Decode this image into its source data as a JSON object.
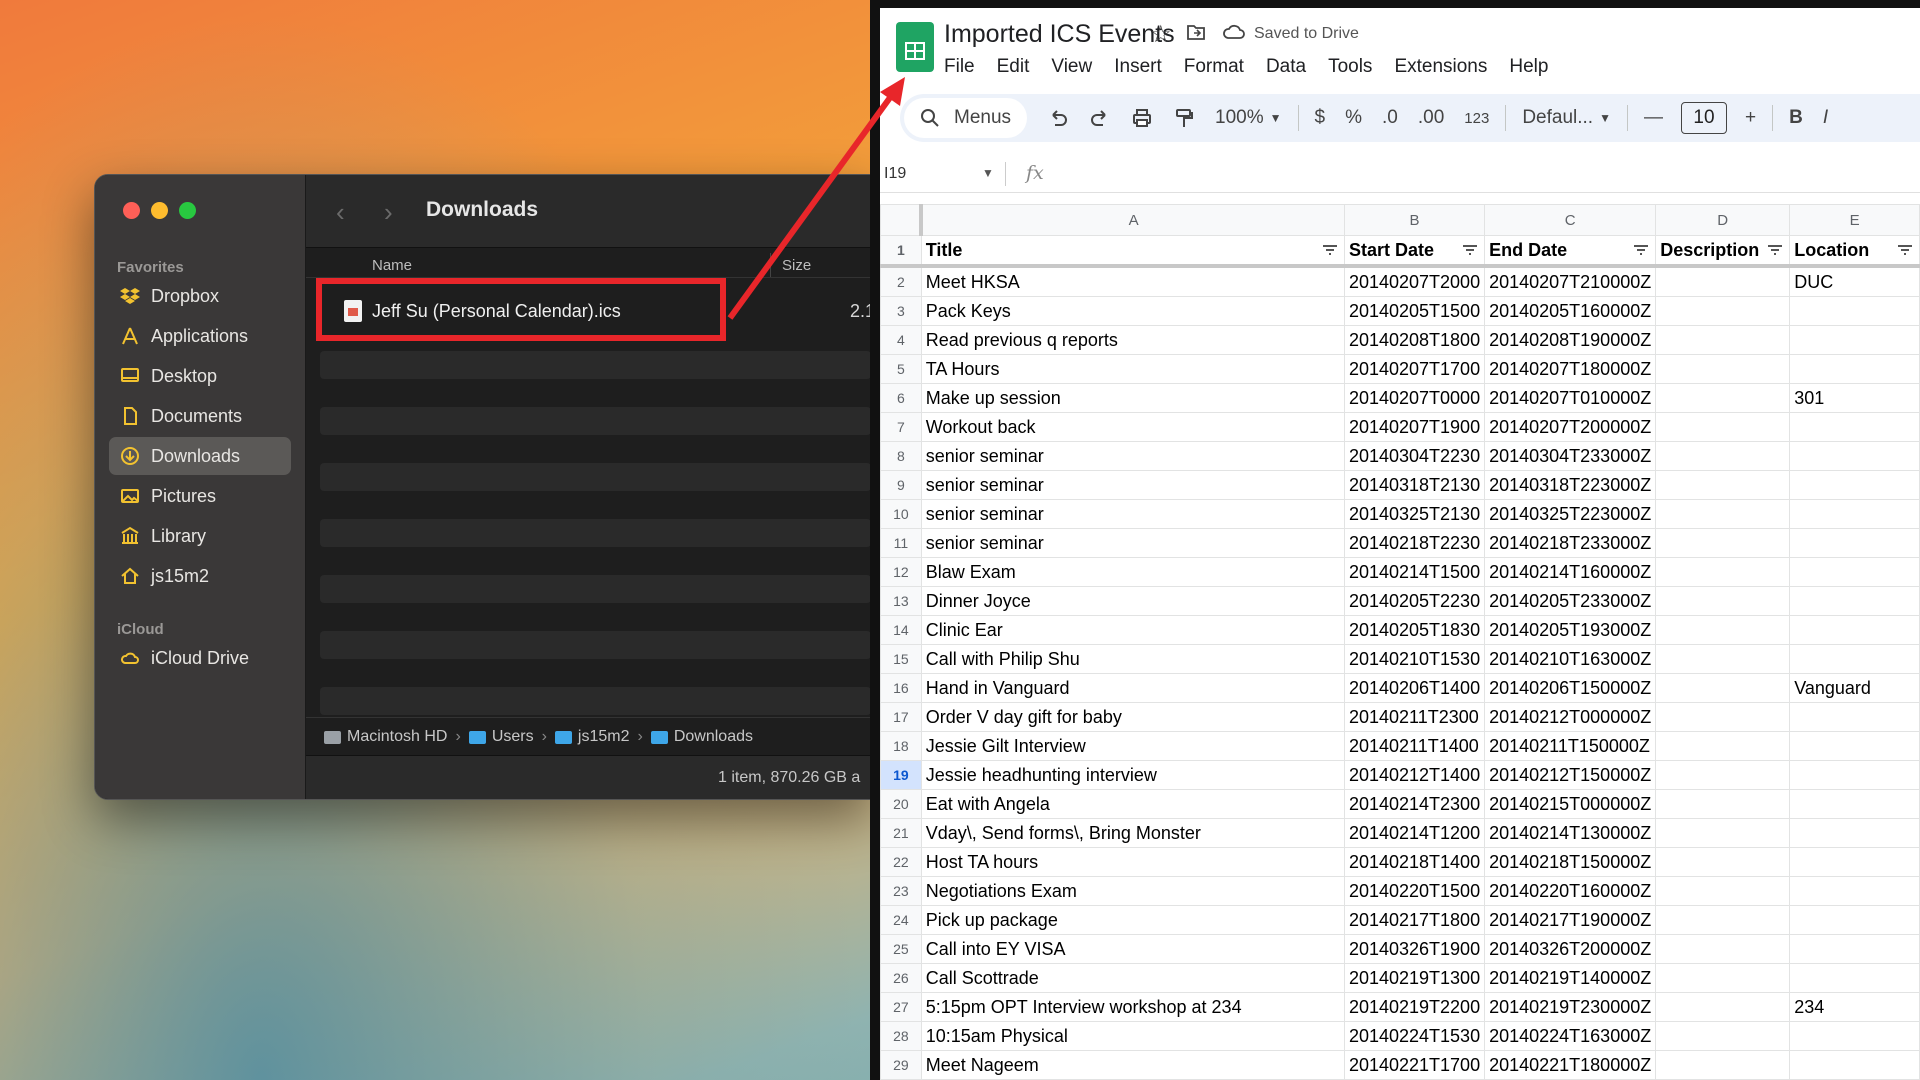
{
  "finder": {
    "title": "Downloads",
    "sidebar": {
      "favorites_label": "Favorites",
      "items": [
        {
          "label": "Dropbox",
          "icon": "dropbox-icon"
        },
        {
          "label": "Applications",
          "icon": "applications-icon"
        },
        {
          "label": "Desktop",
          "icon": "desktop-icon"
        },
        {
          "label": "Documents",
          "icon": "document-icon"
        },
        {
          "label": "Downloads",
          "icon": "downloads-icon",
          "active": true
        },
        {
          "label": "Pictures",
          "icon": "pictures-icon"
        },
        {
          "label": "Library",
          "icon": "library-icon"
        },
        {
          "label": "js15m2",
          "icon": "home-icon"
        }
      ],
      "icloud_label": "iCloud",
      "icloud_items": [
        {
          "label": "iCloud Drive",
          "icon": "cloud-icon"
        }
      ]
    },
    "columns": {
      "name": "Name",
      "size": "Size"
    },
    "file": {
      "name": "Jeff Su (Personal Calendar).ics",
      "size": "2.1"
    },
    "path": [
      "Macintosh HD",
      "Users",
      "js15m2",
      "Downloads"
    ],
    "status": "1 item, 870.26 GB a"
  },
  "sheets": {
    "title": "Imported ICS Events",
    "saved_status": "Saved to Drive",
    "menu": [
      "File",
      "Edit",
      "View",
      "Insert",
      "Format",
      "Data",
      "Tools",
      "Extensions",
      "Help"
    ],
    "toolbar": {
      "search_label": "Menus",
      "zoom": "100%",
      "currency": "$",
      "percent": "%",
      "dec_decrease": ".0",
      "dec_increase": ".00",
      "number_format": "123",
      "font": "Defaul...",
      "font_size": "10",
      "bold": "B",
      "italic": "I"
    },
    "name_box": "I19",
    "fx": "fx",
    "columns": [
      "A",
      "B",
      "C",
      "D",
      "E"
    ],
    "selected_row": 19,
    "header": [
      "Title",
      "Start Date",
      "End Date",
      "Description",
      "Location"
    ],
    "rows": [
      [
        "Meet HKSA",
        "20140207T2000",
        "20140207T210000Z",
        "",
        "DUC"
      ],
      [
        "Pack Keys",
        "20140205T1500",
        "20140205T160000Z",
        "",
        ""
      ],
      [
        "Read previous q reports",
        "20140208T1800",
        "20140208T190000Z",
        "",
        ""
      ],
      [
        "TA Hours",
        "20140207T1700",
        "20140207T180000Z",
        "",
        ""
      ],
      [
        "Make up session",
        "20140207T0000",
        "20140207T010000Z",
        "",
        "301"
      ],
      [
        "Workout back",
        "20140207T1900",
        "20140207T200000Z",
        "",
        ""
      ],
      [
        "senior seminar",
        "20140304T2230",
        "20140304T233000Z",
        "",
        ""
      ],
      [
        "senior seminar",
        "20140318T2130",
        "20140318T223000Z",
        "",
        ""
      ],
      [
        "senior seminar",
        "20140325T2130",
        "20140325T223000Z",
        "",
        ""
      ],
      [
        "senior seminar",
        "20140218T2230",
        "20140218T233000Z",
        "",
        ""
      ],
      [
        "Blaw Exam",
        "20140214T1500",
        "20140214T160000Z",
        "",
        ""
      ],
      [
        "Dinner Joyce",
        "20140205T2230",
        "20140205T233000Z",
        "",
        ""
      ],
      [
        "Clinic Ear",
        "20140205T1830",
        "20140205T193000Z",
        "",
        ""
      ],
      [
        "Call with Philip Shu",
        "20140210T1530",
        "20140210T163000Z",
        "",
        ""
      ],
      [
        "Hand in Vanguard",
        "20140206T1400",
        "20140206T150000Z",
        "",
        "Vanguard"
      ],
      [
        "Order V day gift for baby",
        "20140211T2300",
        "20140212T000000Z",
        "",
        ""
      ],
      [
        "Jessie Gilt Interview",
        "20140211T1400",
        "20140211T150000Z",
        "",
        ""
      ],
      [
        "Jessie headhunting interview",
        "20140212T1400",
        "20140212T150000Z",
        "",
        ""
      ],
      [
        "Eat with Angela",
        "20140214T2300",
        "20140215T000000Z",
        "",
        ""
      ],
      [
        "Vday\\, Send forms\\, Bring Monster",
        "20140214T1200",
        "20140214T130000Z",
        "",
        ""
      ],
      [
        "Host TA hours",
        "20140218T1400",
        "20140218T150000Z",
        "",
        ""
      ],
      [
        "Negotiations Exam",
        "20140220T1500",
        "20140220T160000Z",
        "",
        ""
      ],
      [
        "Pick up package",
        "20140217T1800",
        "20140217T190000Z",
        "",
        ""
      ],
      [
        "Call into EY VISA",
        "20140326T1900",
        "20140326T200000Z",
        "",
        ""
      ],
      [
        "Call Scottrade",
        "20140219T1300",
        "20140219T140000Z",
        "",
        ""
      ],
      [
        "5:15pm OPT Interview workshop at 234",
        "20140219T2200",
        "20140219T230000Z",
        "",
        "234"
      ],
      [
        "10:15am Physical",
        "20140224T1530",
        "20140224T163000Z",
        "",
        ""
      ],
      [
        "Meet Nageem",
        "20140221T1700",
        "20140221T180000Z",
        "",
        ""
      ]
    ]
  },
  "colors": {
    "annotation": "#e8262a",
    "sheets_green": "#1fa463",
    "finder_bg": "#1e1e1e"
  }
}
